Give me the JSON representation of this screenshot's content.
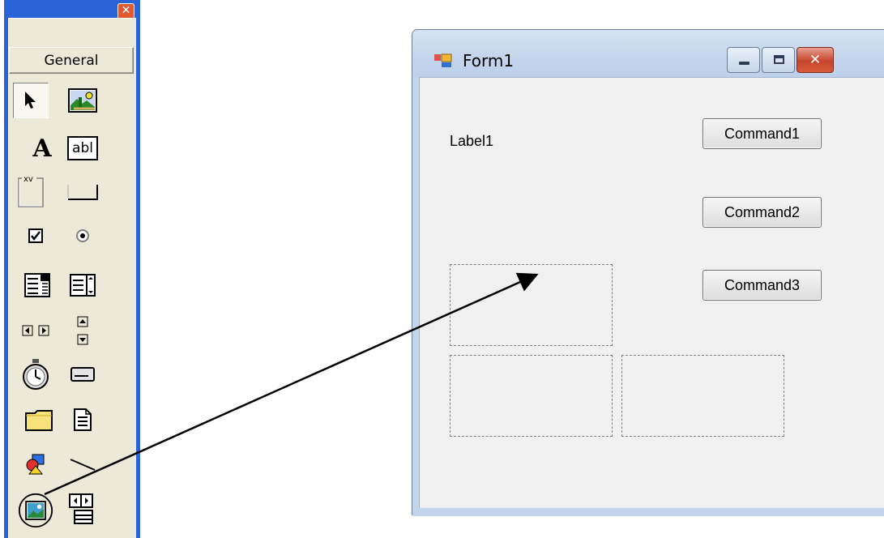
{
  "toolbox": {
    "close_glyph": "✕",
    "tab_label": "General",
    "tools": [
      {
        "name": "pointer-icon"
      },
      {
        "name": "picturebox-icon"
      },
      {
        "name": "label-icon",
        "glyph": "A"
      },
      {
        "name": "textbox-icon",
        "glyph": "abl"
      },
      {
        "name": "frame-icon",
        "glyph": "xv"
      },
      {
        "name": "commandbutton-icon"
      },
      {
        "name": "checkbox-icon"
      },
      {
        "name": "optionbutton-icon"
      },
      {
        "name": "combobox-icon"
      },
      {
        "name": "listbox-icon"
      },
      {
        "name": "hscrollbar-icon"
      },
      {
        "name": "vscrollbar-icon"
      },
      {
        "name": "timer-icon"
      },
      {
        "name": "drivelistbox-icon"
      },
      {
        "name": "dirlistbox-icon"
      },
      {
        "name": "filelistbox-icon"
      },
      {
        "name": "shape-icon"
      },
      {
        "name": "line-icon"
      },
      {
        "name": "image-icon",
        "highlighted": true
      },
      {
        "name": "data-icon"
      }
    ]
  },
  "form": {
    "title": "Form1",
    "label1": "Label1",
    "buttons": [
      "Command1",
      "Command2",
      "Command3"
    ],
    "close_glyph": "✕"
  },
  "colors": {
    "toolbox_frame": "#2a63d6",
    "toolbox_bg": "#ece9d8",
    "form_bg": "#f0f0f0",
    "titlebar": "#c3d5ec",
    "close_button": "#c5442c"
  }
}
